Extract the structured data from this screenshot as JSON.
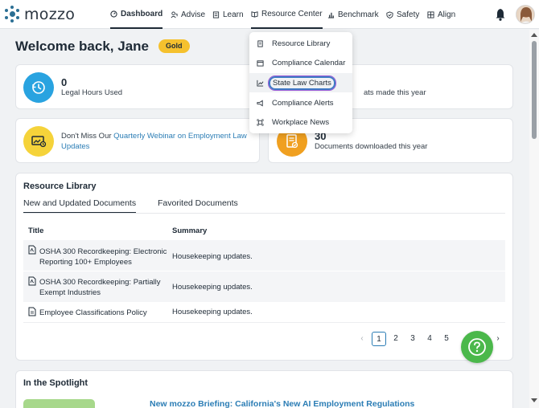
{
  "brand": {
    "name": "mozzo"
  },
  "nav": {
    "items": [
      {
        "label": "Dashboard",
        "icon": "dashboard-icon"
      },
      {
        "label": "Advise",
        "icon": "advise-icon"
      },
      {
        "label": "Learn",
        "icon": "learn-icon"
      },
      {
        "label": "Resource Center",
        "icon": "book-icon"
      },
      {
        "label": "Benchmark",
        "icon": "chart-icon"
      },
      {
        "label": "Safety",
        "icon": "shield-icon"
      },
      {
        "label": "Align",
        "icon": "grid-icon"
      }
    ]
  },
  "resource_menu": {
    "items": [
      {
        "label": "Resource Library",
        "icon": "document-icon"
      },
      {
        "label": "Compliance Calendar",
        "icon": "calendar-icon"
      },
      {
        "label": "State Law Charts",
        "icon": "line-chart-icon"
      },
      {
        "label": "Compliance Alerts",
        "icon": "megaphone-icon"
      },
      {
        "label": "Workplace News",
        "icon": "news-icon"
      }
    ]
  },
  "welcome": {
    "title": "Welcome back, Jane",
    "tier": "Gold"
  },
  "stats": {
    "legal_hours": {
      "value": "0",
      "label": "Legal Hours Used"
    },
    "requests": {
      "label": "ats made this year"
    },
    "documents": {
      "value": "30",
      "label": "Documents downloaded this year"
    }
  },
  "webinar": {
    "prefix": "Don't Miss Our ",
    "link": "Quarterly Webinar on Employment Law Updates"
  },
  "library": {
    "title": "Resource Library",
    "tabs": [
      "New and Updated Documents",
      "Favorited Documents"
    ],
    "columns": [
      "Title",
      "Summary"
    ],
    "rows": [
      {
        "title": "OSHA 300 Recordkeeping: Electronic Reporting 100+ Employees",
        "summary": "Housekeeping updates.",
        "icon": "pdf-icon"
      },
      {
        "title": "OSHA 300 Recordkeeping: Partially Exempt Industries",
        "summary": "Housekeeping updates.",
        "icon": "pdf-icon"
      },
      {
        "title": "Employee Classifications Policy",
        "summary": "Housekeeping updates.",
        "icon": "doc-icon"
      }
    ],
    "pagination": {
      "prev": "‹",
      "pages": [
        "1",
        "2",
        "3",
        "4",
        "5"
      ],
      "next": "›",
      "current": "1"
    }
  },
  "spotlight": {
    "title": "In the Spotlight",
    "headline": "New mozzo Briefing: California's New AI Employment Regulations"
  },
  "colors": {
    "accent_blue": "#29a3e0",
    "gold": "#f5c12e",
    "orange": "#f0a020",
    "link": "#2b7db5",
    "help_green": "#4bb84b"
  }
}
